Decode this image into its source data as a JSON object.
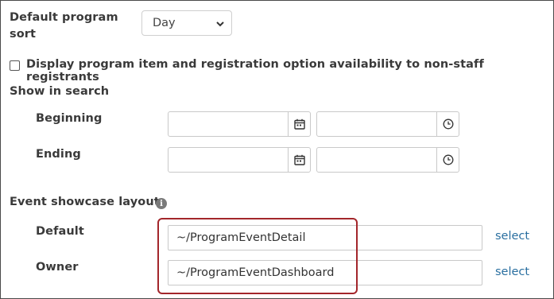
{
  "default_program_sort": {
    "label_line1": "Default program",
    "label_line2": "sort",
    "selected": "Day"
  },
  "availability": {
    "label": "Display program item and registration option availability to non-staff registrants",
    "checked": false
  },
  "show_in_search": {
    "heading": "Show in search",
    "beginning_label": "Beginning",
    "ending_label": "Ending",
    "beginning_date": "",
    "beginning_time": "",
    "ending_date": "",
    "ending_time": ""
  },
  "event_showcase": {
    "heading": "Event showcase layout",
    "info_glyph": "i",
    "default_label": "Default",
    "default_value": "~/ProgramEventDetail",
    "owner_label": "Owner",
    "owner_value": "~/ProgramEventDashboard",
    "select_label": "select"
  },
  "colors": {
    "highlight": "#a3262b",
    "link": "#2a6fa0"
  }
}
